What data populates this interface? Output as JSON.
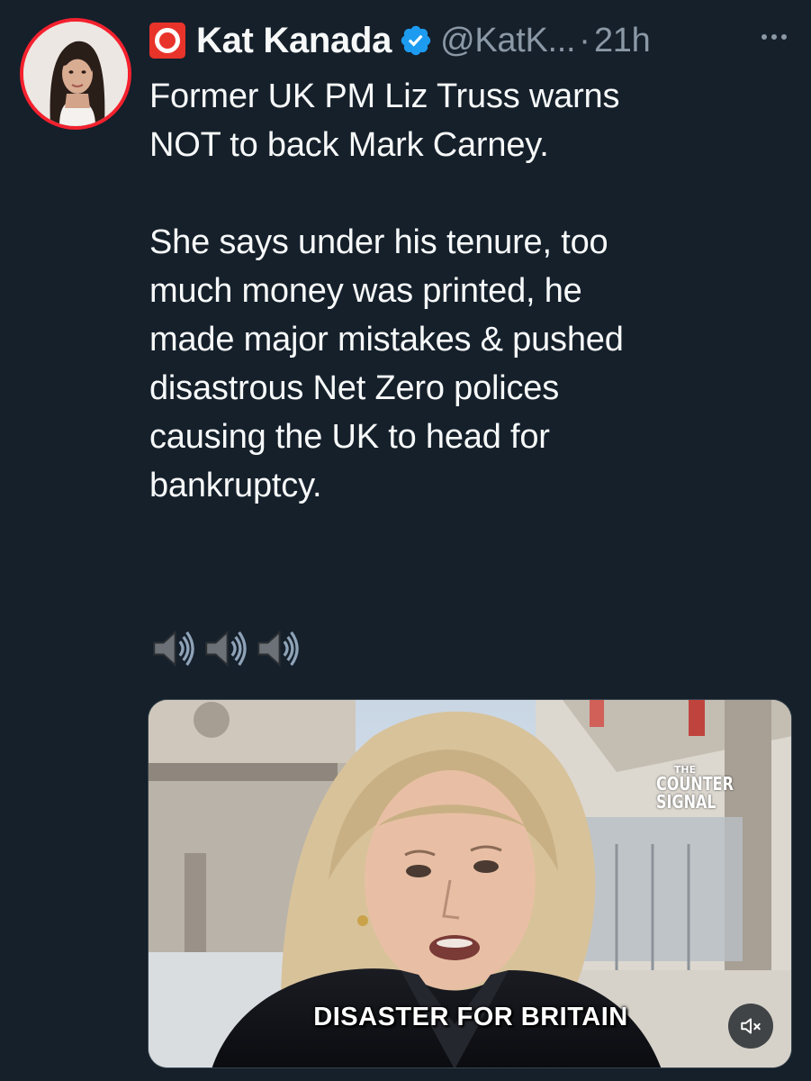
{
  "author": {
    "display_name": "Kat Kanada",
    "handle": "@KatK...",
    "separator": "·",
    "time": "21h",
    "badge_icon": "red-o-emoji-icon",
    "verified_icon": "verified-badge-icon",
    "verified_color": "#1d9bf0"
  },
  "tweet": {
    "line1": "Former UK PM Liz Truss warns",
    "line2": "NOT to back Mark Carney.",
    "para2": [
      "She says under his tenure, too",
      "much money  was printed, he",
      "made major mistakes & pushed",
      "disastrous Net Zero polices",
      "causing the UK to head for",
      "bankruptcy."
    ],
    "emoji": [
      "speaker-icon",
      "speaker-icon",
      "speaker-icon"
    ]
  },
  "media": {
    "caption": "DISASTER FOR BRITAIN",
    "watermark": {
      "line1": "THE",
      "line2": "COUNTER",
      "line3": "SIGNAL"
    },
    "mute_icon": "speaker-muted-icon"
  },
  "colors": {
    "background": "#15202b",
    "text": "#f7f9f9",
    "secondary": "#8b98a5",
    "avatar_ring": "#f4212e"
  }
}
